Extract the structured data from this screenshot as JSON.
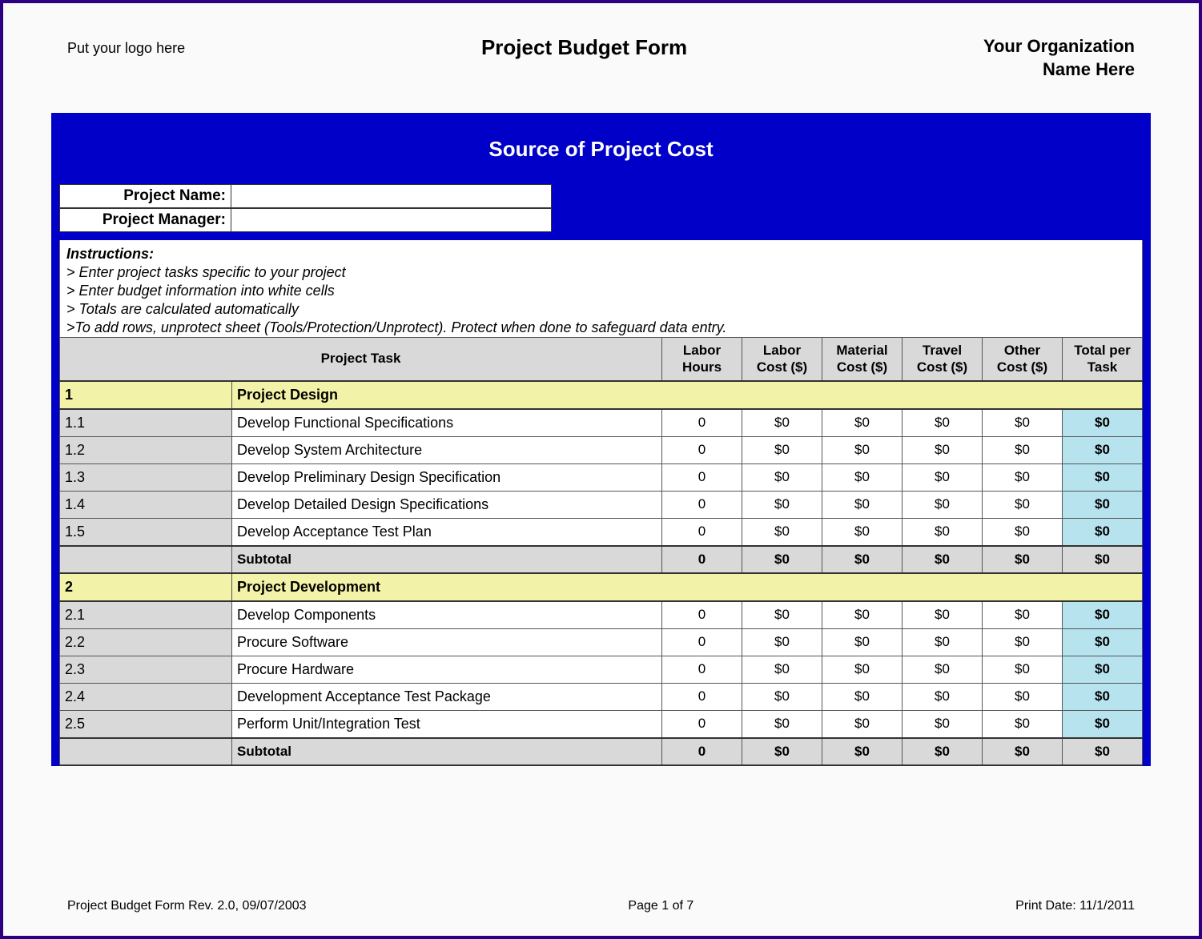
{
  "header": {
    "logo_text": "Put your logo here",
    "title": "Project Budget Form",
    "org_line1": "Your Organization",
    "org_line2": "Name Here"
  },
  "box": {
    "banner": "Source of Project Cost",
    "project_name_label": "Project Name:",
    "project_manager_label": "Project Manager:",
    "project_name_value": "",
    "project_manager_value": ""
  },
  "instructions": {
    "title": "Instructions:",
    "lines": [
      " > Enter project tasks specific to your project",
      " > Enter budget information into white cells",
      " > Totals are calculated automatically",
      " >To add rows, unprotect sheet (Tools/Protection/Unprotect).  Protect when done to safeguard data entry."
    ]
  },
  "columns": {
    "task": "Project Task",
    "labor_hours": "Labor Hours",
    "labor_cost": "Labor Cost ($)",
    "material_cost": "Material Cost ($)",
    "travel_cost": "Travel Cost ($)",
    "other_cost": "Other Cost ($)",
    "total": "Total per Task"
  },
  "sections": [
    {
      "num": "1",
      "title": "Project Design",
      "rows": [
        {
          "id": "1.1",
          "task": "Develop Functional Specifications",
          "hrs": "0",
          "lab": "$0",
          "mat": "$0",
          "trv": "$0",
          "oth": "$0",
          "tot": "$0"
        },
        {
          "id": "1.2",
          "task": "Develop System Architecture",
          "hrs": "0",
          "lab": "$0",
          "mat": "$0",
          "trv": "$0",
          "oth": "$0",
          "tot": "$0"
        },
        {
          "id": "1.3",
          "task": "Develop Preliminary Design Specification",
          "hrs": "0",
          "lab": "$0",
          "mat": "$0",
          "trv": "$0",
          "oth": "$0",
          "tot": "$0"
        },
        {
          "id": "1.4",
          "task": "Develop Detailed Design Specifications",
          "hrs": "0",
          "lab": "$0",
          "mat": "$0",
          "trv": "$0",
          "oth": "$0",
          "tot": "$0"
        },
        {
          "id": "1.5",
          "task": "Develop Acceptance Test Plan",
          "hrs": "0",
          "lab": "$0",
          "mat": "$0",
          "trv": "$0",
          "oth": "$0",
          "tot": "$0"
        }
      ],
      "subtotal": {
        "label": "Subtotal",
        "hrs": "0",
        "lab": "$0",
        "mat": "$0",
        "trv": "$0",
        "oth": "$0",
        "tot": "$0"
      }
    },
    {
      "num": "2",
      "title": "Project Development",
      "rows": [
        {
          "id": "2.1",
          "task": "Develop Components",
          "hrs": "0",
          "lab": "$0",
          "mat": "$0",
          "trv": "$0",
          "oth": "$0",
          "tot": "$0"
        },
        {
          "id": "2.2",
          "task": "Procure Software",
          "hrs": "0",
          "lab": "$0",
          "mat": "$0",
          "trv": "$0",
          "oth": "$0",
          "tot": "$0"
        },
        {
          "id": "2.3",
          "task": "Procure Hardware",
          "hrs": "0",
          "lab": "$0",
          "mat": "$0",
          "trv": "$0",
          "oth": "$0",
          "tot": "$0"
        },
        {
          "id": "2.4",
          "task": "Development Acceptance Test Package",
          "hrs": "0",
          "lab": "$0",
          "mat": "$0",
          "trv": "$0",
          "oth": "$0",
          "tot": "$0"
        },
        {
          "id": "2.5",
          "task": "Perform Unit/Integration Test",
          "hrs": "0",
          "lab": "$0",
          "mat": "$0",
          "trv": "$0",
          "oth": "$0",
          "tot": "$0"
        }
      ],
      "subtotal": {
        "label": "Subtotal",
        "hrs": "0",
        "lab": "$0",
        "mat": "$0",
        "trv": "$0",
        "oth": "$0",
        "tot": "$0"
      }
    }
  ],
  "footer": {
    "rev": "Project Budget Form Rev. 2.0, 09/07/2003",
    "page": "Page 1 of 7",
    "print": "Print Date: 11/1/2011"
  }
}
